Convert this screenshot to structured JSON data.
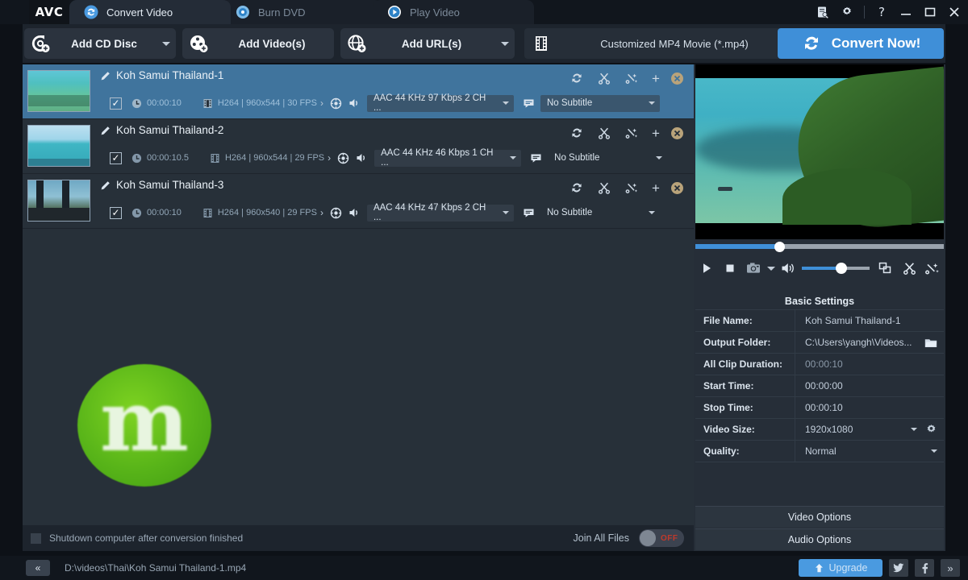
{
  "titlebar": {
    "logo": "AVC",
    "tabs": [
      {
        "label": "Convert Video",
        "icon": "convert-icon",
        "active": true
      },
      {
        "label": "Burn DVD",
        "icon": "disc-icon",
        "active": false
      },
      {
        "label": "Play Video",
        "icon": "play-icon",
        "active": false
      }
    ],
    "window_controls": {
      "log": "log-icon",
      "settings": "gear-icon",
      "help": "?",
      "minimize": "—",
      "maximize": "❐",
      "close": "✕"
    }
  },
  "toolbar": {
    "add_cd_disc": "Add CD Disc",
    "add_videos": "Add Video(s)",
    "add_urls": "Add URL(s)",
    "profile": "Customized MP4 Movie (*.mp4)",
    "convert": "Convert Now!"
  },
  "video_list": [
    {
      "name": "Koh Samui Thailand-1",
      "checked": "✓",
      "duration": "00:00:10",
      "format": "H264 | 960x544 | 30 FPS",
      "audio": "AAC 44 KHz 97 Kbps 2 CH ...",
      "subtitle": "No Subtitle",
      "selected": true
    },
    {
      "name": "Koh Samui Thailand-2",
      "checked": "✓",
      "duration": "00:00:10.5",
      "format": "H264 | 960x544 | 29 FPS",
      "audio": "AAC 44 KHz 46 Kbps 1 CH ...",
      "subtitle": "No Subtitle",
      "selected": false
    },
    {
      "name": "Koh Samui Thailand-3",
      "checked": "✓",
      "duration": "00:00:10",
      "format": "H264 | 960x540 | 29 FPS",
      "audio": "AAC 44 KHz 47 Kbps 2 CH ...",
      "subtitle": "No Subtitle",
      "selected": false
    }
  ],
  "row_actions": {
    "rotate": "rotate-icon",
    "cut": "scissors-icon",
    "effect": "effect-icon",
    "add": "+",
    "remove": "✕"
  },
  "bottom_strip": {
    "shutdown_label": "Shutdown computer after conversion finished",
    "join_label": "Join All Files",
    "join_state": "OFF"
  },
  "player": {
    "play": "play-icon",
    "stop": "stop-icon",
    "snapshot": "camera-icon",
    "volume": "volume-icon",
    "crop": "crop-icon",
    "trim": "scissors-icon",
    "effect": "effect-icon",
    "seek_percent": 34,
    "volume_percent": 57
  },
  "basic_settings": {
    "title": "Basic Settings",
    "rows": [
      {
        "label": "File Name:",
        "value": "Koh Samui Thailand-1",
        "muted": false
      },
      {
        "label": "Output Folder:",
        "value": "C:\\Users\\yangh\\Videos...",
        "muted": false,
        "accessory": "folder-icon"
      },
      {
        "label": "All Clip Duration:",
        "value": "00:00:10",
        "muted": true
      },
      {
        "label": "Start Time:",
        "value": "00:00:00",
        "muted": false
      },
      {
        "label": "Stop Time:",
        "value": "00:00:10",
        "muted": false
      },
      {
        "label": "Video Size:",
        "value": "1920x1080",
        "muted": false,
        "accessory": "caret+gear"
      },
      {
        "label": "Quality:",
        "value": "Normal",
        "muted": false,
        "accessory": "caret"
      }
    ]
  },
  "option_buttons": {
    "video_options": "Video Options",
    "audio_options": "Audio Options"
  },
  "statusbar": {
    "collapse": "«",
    "path": "D:\\videos\\Thai\\Koh Samui Thailand-1.mp4",
    "upgrade": "Upgrade",
    "twitter": "twitter-icon",
    "facebook": "facebook-icon",
    "more": "»"
  },
  "colors": {
    "accent": "#3f8fd8",
    "selected_row": "#40749d",
    "panel": "#262e38",
    "list_bg": "#273039",
    "titlebar": "#11161d"
  }
}
